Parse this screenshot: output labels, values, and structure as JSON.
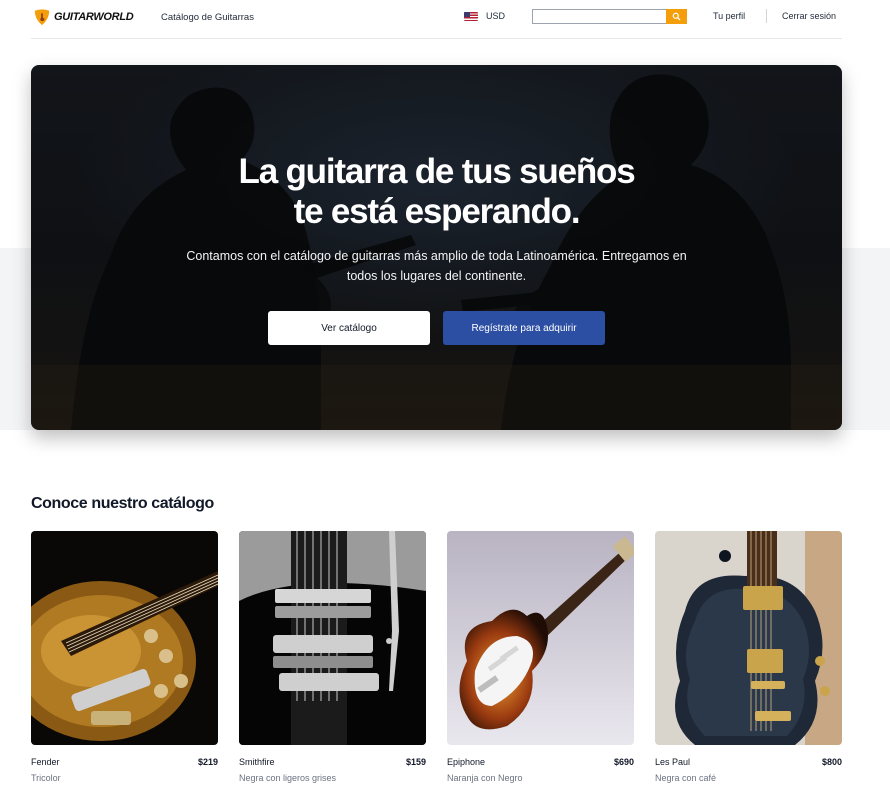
{
  "header": {
    "brand": "GUITARWORLD",
    "nav_catalog": "Catálogo de Guitarras",
    "currency": "USD",
    "search_placeholder": "",
    "profile": "Tu perfil",
    "logout": "Cerrar sesión"
  },
  "hero": {
    "title_line1": "La guitarra de tus sueños",
    "title_line2": "te está esperando.",
    "subtitle": "Contamos con el catálogo de guitarras más amplio de toda Latinoamérica. Entregamos en todos los lugares del continente.",
    "btn_catalog": "Ver catálogo",
    "btn_register": "Regístrate para adquirir"
  },
  "catalog": {
    "title": "Conoce nuestro catálogo",
    "items": [
      {
        "name": "Fender",
        "price": "$219",
        "color": "Tricolor"
      },
      {
        "name": "Smithfire",
        "price": "$159",
        "color": "Negra con ligeros grises"
      },
      {
        "name": "Epiphone",
        "price": "$690",
        "color": "Naranja con Negro"
      },
      {
        "name": "Les Paul",
        "price": "$800",
        "color": "Negra con café"
      }
    ]
  },
  "colors": {
    "accent": "#f59e0b",
    "primary_button": "#2c4fa3"
  },
  "icons": {
    "logo": "guitar-pick-logo-icon",
    "flag": "us-flag-icon",
    "search": "search-icon"
  }
}
